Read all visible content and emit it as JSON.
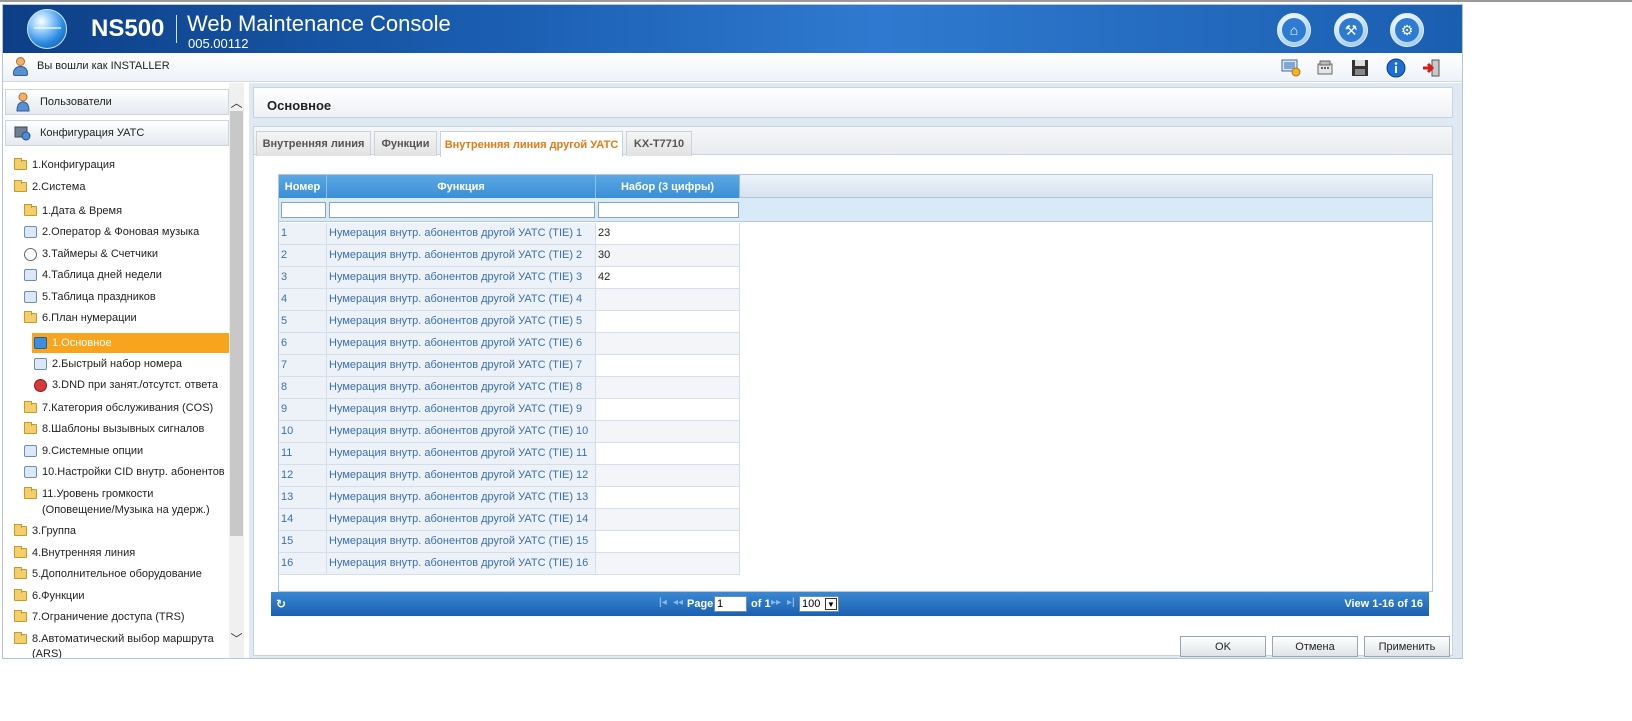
{
  "header": {
    "brand": "NS500",
    "title": "Web Maintenance Console",
    "version": "005.00112"
  },
  "userbar": {
    "logged_in_text": "Вы вошли как INSTALLER"
  },
  "sidebar": {
    "sections": [
      {
        "label": "Пользователи",
        "icon": "user-icon"
      },
      {
        "label": "Конфигурация УАТС",
        "icon": "pbx-config-icon"
      }
    ],
    "tree": [
      {
        "label": "1.Конфигурация",
        "icon": "folder-icon"
      },
      {
        "label": "2.Система",
        "icon": "folder-open-icon"
      },
      {
        "label": "1.Дата & Время",
        "icon": "folder-icon"
      },
      {
        "label": "2.Оператор & Фоновая музыка",
        "icon": "operator-icon"
      },
      {
        "label": "3.Таймеры & Счетчики",
        "icon": "clock-icon"
      },
      {
        "label": "4.Таблица дней недели",
        "icon": "calendar-icon"
      },
      {
        "label": "5.Таблица праздников",
        "icon": "holiday-icon"
      },
      {
        "label": "6.План нумерации",
        "icon": "folder-open-icon"
      },
      {
        "label": "1.Основное",
        "icon": "cube-icon"
      },
      {
        "label": "2.Быстрый набор номера",
        "icon": "speed-dial-icon"
      },
      {
        "label": "3.DND при занят./отсутст. ответа",
        "icon": "dnd-icon"
      },
      {
        "label": "7.Категория обслуживания (COS)",
        "icon": "folder-icon"
      },
      {
        "label": "8.Шаблоны вызывных сигналов",
        "icon": "folder-icon"
      },
      {
        "label": "9.Системные опции",
        "icon": "options-icon"
      },
      {
        "label": "10.Настройки CID внутр. абонентов",
        "icon": "cid-icon"
      },
      {
        "label": "11.Уровень громкости",
        "icon": "folder-icon"
      },
      {
        "label": "(Оповещение/Музыка на удерж.)",
        "icon": ""
      },
      {
        "label": "3.Группа",
        "icon": "folder-icon"
      },
      {
        "label": "4.Внутренняя линия",
        "icon": "folder-icon"
      },
      {
        "label": "5.Дополнительное оборудование",
        "icon": "folder-icon"
      },
      {
        "label": "6.Функции",
        "icon": "folder-icon"
      },
      {
        "label": "7.Ограничение доступа (TRS)",
        "icon": "folder-icon"
      },
      {
        "label": "8.Автоматический выбор маршрута",
        "icon": "folder-icon"
      },
      {
        "label": "(ARS)",
        "icon": ""
      }
    ]
  },
  "main": {
    "title": "Основное",
    "tabs": [
      {
        "label": "Внутренняя линия",
        "active": false
      },
      {
        "label": "Функции",
        "active": false
      },
      {
        "label": "Внутренняя линия другой УАТС",
        "active": true
      },
      {
        "label": "KX-T7710",
        "active": false
      }
    ],
    "table": {
      "columns": [
        "Номер",
        "Функция",
        "Набор (3 цифры)"
      ],
      "rows": [
        {
          "num": "1",
          "func": "Нумерация внутр. абонентов другой УАТС (TIE) 1",
          "dial": "23"
        },
        {
          "num": "2",
          "func": "Нумерация внутр. абонентов другой УАТС (TIE) 2",
          "dial": "30"
        },
        {
          "num": "3",
          "func": "Нумерация внутр. абонентов другой УАТС (TIE) 3",
          "dial": "42"
        },
        {
          "num": "4",
          "func": "Нумерация внутр. абонентов другой УАТС (TIE) 4",
          "dial": ""
        },
        {
          "num": "5",
          "func": "Нумерация внутр. абонентов другой УАТС (TIE) 5",
          "dial": ""
        },
        {
          "num": "6",
          "func": "Нумерация внутр. абонентов другой УАТС (TIE) 6",
          "dial": ""
        },
        {
          "num": "7",
          "func": "Нумерация внутр. абонентов другой УАТС (TIE) 7",
          "dial": ""
        },
        {
          "num": "8",
          "func": "Нумерация внутр. абонентов другой УАТС (TIE) 8",
          "dial": ""
        },
        {
          "num": "9",
          "func": "Нумерация внутр. абонентов другой УАТС (TIE) 9",
          "dial": ""
        },
        {
          "num": "10",
          "func": "Нумерация внутр. абонентов другой УАТС (TIE) 10",
          "dial": ""
        },
        {
          "num": "11",
          "func": "Нумерация внутр. абонентов другой УАТС (TIE) 11",
          "dial": ""
        },
        {
          "num": "12",
          "func": "Нумерация внутр. абонентов другой УАТС (TIE) 12",
          "dial": ""
        },
        {
          "num": "13",
          "func": "Нумерация внутр. абонентов другой УАТС (TIE) 13",
          "dial": ""
        },
        {
          "num": "14",
          "func": "Нумерация внутр. абонентов другой УАТС (TIE) 14",
          "dial": ""
        },
        {
          "num": "15",
          "func": "Нумерация внутр. абонентов другой УАТС (TIE) 15",
          "dial": ""
        },
        {
          "num": "16",
          "func": "Нумерация внутр. абонентов другой УАТС (TIE) 16",
          "dial": ""
        }
      ]
    },
    "pager": {
      "page_label": "Page",
      "page_value": "1",
      "of_label": "of 1",
      "rows_per_page": "100",
      "view_text": "View 1-16 of 16"
    },
    "buttons": {
      "ok": "OK",
      "cancel": "Отмена",
      "apply": "Применить"
    }
  },
  "colors": {
    "header_blue": "#1b5fb3",
    "active_tab_text": "#e37a16",
    "tree_selected": "#f8a51d",
    "grid_header": "#3b8ed6"
  }
}
